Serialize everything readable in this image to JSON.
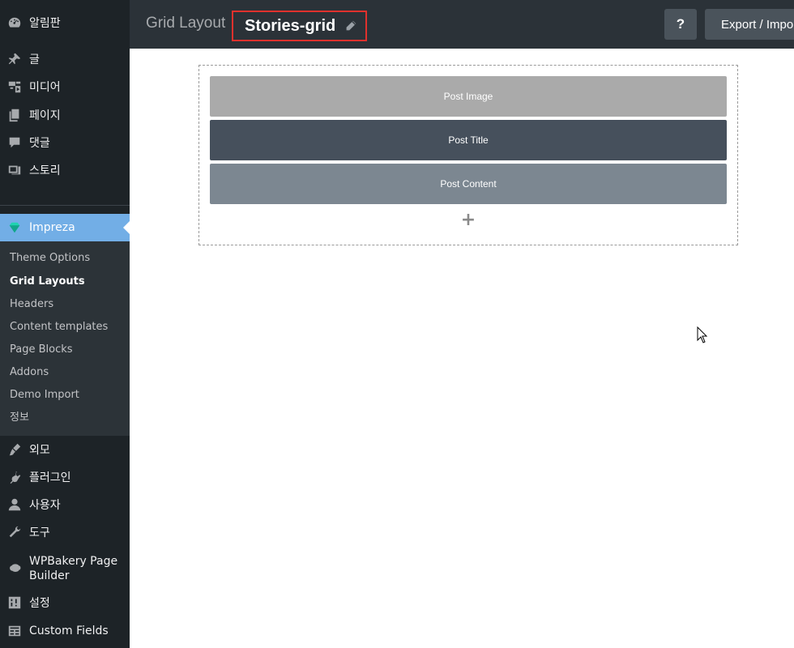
{
  "sidebar": {
    "top_items": [
      {
        "label": "알림판",
        "icon": "dashboard-icon"
      },
      {
        "label": "글",
        "icon": "pin-icon"
      },
      {
        "label": "미디어",
        "icon": "media-icon"
      },
      {
        "label": "페이지",
        "icon": "pages-icon"
      },
      {
        "label": "댓글",
        "icon": "comments-icon"
      },
      {
        "label": "스토리",
        "icon": "stories-icon"
      }
    ],
    "impreza": {
      "label": "Impreza",
      "icon": "impreza-gem-icon"
    },
    "submenu": [
      {
        "label": "Theme Options"
      },
      {
        "label": "Grid Layouts",
        "current": true
      },
      {
        "label": "Headers"
      },
      {
        "label": "Content templates"
      },
      {
        "label": "Page Blocks"
      },
      {
        "label": "Addons"
      },
      {
        "label": "Demo Import"
      },
      {
        "label": "정보"
      }
    ],
    "bottom_items": [
      {
        "label": "외모",
        "icon": "appearance-icon"
      },
      {
        "label": "플러그인",
        "icon": "plugins-icon"
      },
      {
        "label": "사용자",
        "icon": "users-icon"
      },
      {
        "label": "도구",
        "icon": "tools-icon"
      },
      {
        "label": "WPBakery Page Builder",
        "icon": "wpbakery-icon"
      },
      {
        "label": "설정",
        "icon": "settings-icon"
      },
      {
        "label": "Custom Fields",
        "icon": "custom-fields-icon"
      }
    ]
  },
  "header": {
    "breadcrumb": "Grid Layout",
    "title": "Stories-grid",
    "help_label": "?",
    "export_label": "Export / Import"
  },
  "editor": {
    "blocks": [
      {
        "label": "Post Image"
      },
      {
        "label": "Post Title"
      },
      {
        "label": "Post Content"
      }
    ],
    "add_label": "+"
  },
  "colors": {
    "sidebar_bg": "#1d2327",
    "active_menu": "#72aee6",
    "topbar_bg": "#2b3238",
    "highlight_border": "#e0312d"
  }
}
